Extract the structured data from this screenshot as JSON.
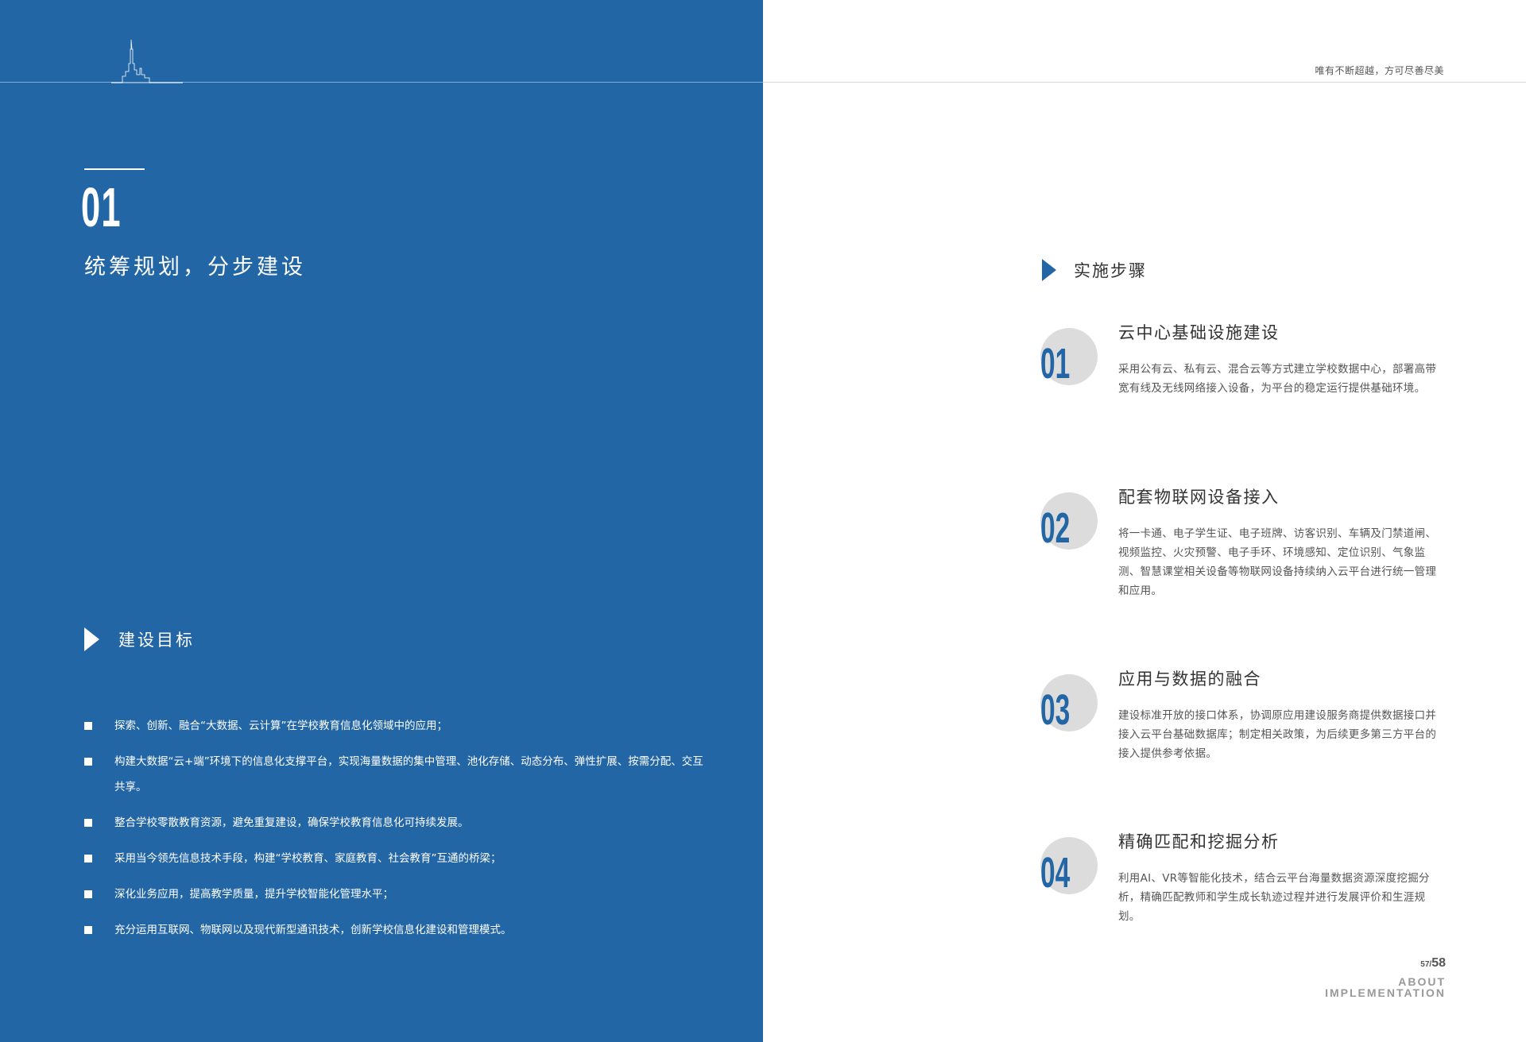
{
  "left": {
    "section_number": "01",
    "section_title": "统筹规划，分步建设",
    "goals_heading": "建设目标",
    "goals": [
      "探索、创新、融合“大数据、云计算”在学校教育信息化领域中的应用；",
      "构建大数据“云+端”环境下的信息化支撑平台，实现海量数据的集中管理、池化存储、动态分布、弹性扩展、按需分配、交互共享。",
      "整合学校零散教育资源，避免重复建设，确保学校教育信息化可持续发展。",
      "采用当今领先信息技术手段，构建“学校教育、家庭教育、社会教育”互通的桥梁；",
      "深化业务应用，提高教学质量，提升学校智能化管理水平；",
      "充分运用互联网、物联网以及现代新型通讯技术，创新学校信息化建设和管理模式。"
    ]
  },
  "right": {
    "slogan": "唯有不断超越，方可尽善尽美",
    "steps_heading": "实施步骤",
    "steps": [
      {
        "number": "01",
        "title": "云中心基础设施建设",
        "body": "采用公有云、私有云、混合云等方式建立学校数据中心，部署高带宽有线及无线网络接入设备，为平台的稳定运行提供基础环境。"
      },
      {
        "number": "02",
        "title": "配套物联网设备接入",
        "body": "将一卡通、电子学生证、电子班牌、访客识别、车辆及门禁道闸、视频监控、火灾预警、电子手环、环境感知、定位识别、气象监测、智慧课堂相关设备等物联网设备持续纳入云平台进行统一管理和应用。"
      },
      {
        "number": "03",
        "title": "应用与数据的融合",
        "body": "建设标准开放的接口体系，协调原应用建设服务商提供数据接口并接入云平台基础数据库；制定相关政策，为后续更多第三方平台的接入提供参考依据。"
      },
      {
        "number": "04",
        "title": "精确匹配和挖掘分析",
        "body": "利用AI、VR等智能化技术，结合云平台海量数据资源深度挖掘分析，精确匹配教师和学生成长轨迹过程并进行发展评价和生涯规划。"
      }
    ],
    "page_left": "57",
    "page_sep": "/",
    "page_right": "58",
    "footer_line1": "ABOUT",
    "footer_line2": "IMPLEMENTATION"
  },
  "colors": {
    "brand_blue": "#2366a6",
    "badge_gray": "#dcdcdc"
  },
  "icons": {
    "skyline": "city-skyline-icon",
    "heading_marker": "triangle-right-icon",
    "bullet": "square-bullet-icon"
  }
}
